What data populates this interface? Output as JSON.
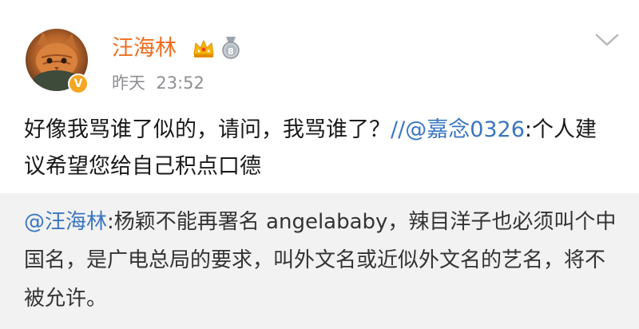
{
  "post": {
    "author": "汪海林",
    "timestamp": "昨天  23:52",
    "badge_verified": "V",
    "badge_medal_text": "8",
    "icons": [
      "crown-vip-icon",
      "medal-icon",
      "chevron-down-icon",
      "verified-badge-icon"
    ],
    "content": {
      "text": "好像我骂谁了似的，请问，我骂谁了？",
      "repost_sep": "//",
      "mention": "@嘉念0326",
      "repost_text": ":个人建议希望您给自己积点口德"
    },
    "quoted": {
      "mention": "@汪海林",
      "text": ":杨颖不能再署名 angelababy，辣目洋子也必须叫个中国名，是广电总局的要求，叫外文名或近似外文名的艺名，将不被允许。"
    }
  },
  "colors": {
    "username": "#f06d1e",
    "link": "#3a76c2",
    "timestamp": "#8e8e93",
    "quote_bg": "#f2f2f2",
    "badge": "#f5a623"
  }
}
